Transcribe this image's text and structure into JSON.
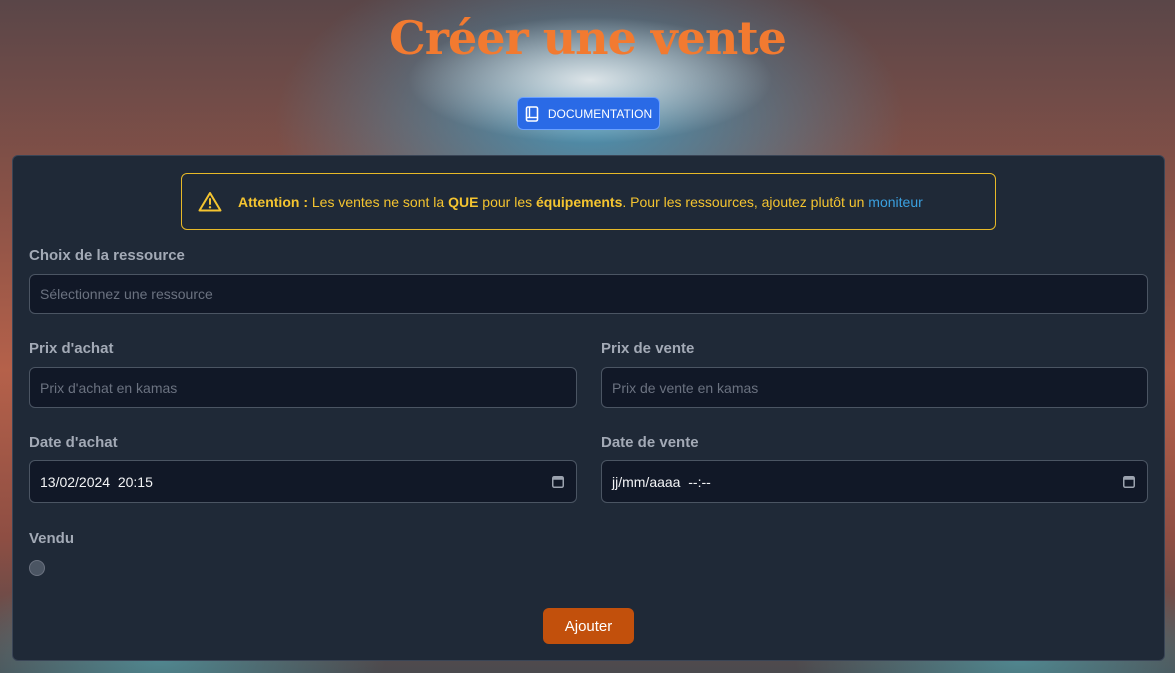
{
  "page": {
    "title": "Créer une vente"
  },
  "doc_button": {
    "label": "DOCUMENTATION",
    "icon": "book-icon"
  },
  "alert": {
    "icon": "warning-triangle-icon",
    "bold_prefix": "Attention :",
    "text_1": " Les ventes ne sont la ",
    "bold_1": "QUE",
    "text_2": " pour les ",
    "bold_2": "équipements",
    "text_3": ". Pour les ressources, ajoutez plutôt un ",
    "link": "moniteur"
  },
  "form": {
    "resource": {
      "label": "Choix de la ressource",
      "placeholder": "Sélectionnez une ressource"
    },
    "purchase_price": {
      "label": "Prix d'achat",
      "placeholder": "Prix d'achat en kamas"
    },
    "sale_price": {
      "label": "Prix de vente",
      "placeholder": "Prix de vente en kamas"
    },
    "purchase_date": {
      "label": "Date d'achat",
      "value": "13/02/2024  20:15"
    },
    "sale_date": {
      "label": "Date de vente",
      "value": "jj/mm/aaaa  --:--"
    },
    "sold": {
      "label": "Vendu",
      "checked": false
    },
    "submit_label": "Ajouter"
  },
  "colors": {
    "title": "#f27a30",
    "doc_button": "#2a6ae6",
    "alert": "#f4c430",
    "link": "#3aa0e0",
    "submit": "#c2500c",
    "card": "#1f2937",
    "input_bg": "#111827"
  }
}
